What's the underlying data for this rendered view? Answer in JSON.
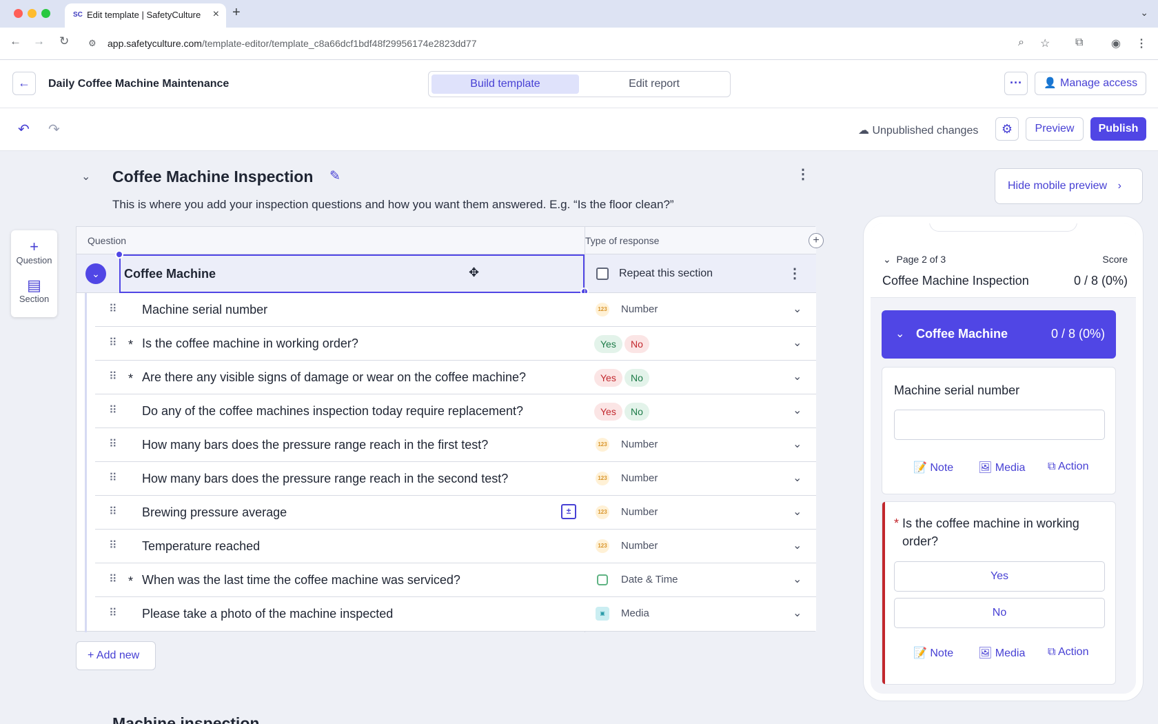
{
  "browser": {
    "tab_title": "Edit template | SafetyCulture",
    "tab_favicon": "SC",
    "url_domain": "app.safetyculture.com",
    "url_path": "/template-editor/template_c8a66dcf1bdf48f29956174e2823dd77"
  },
  "header": {
    "template_name": "Daily Coffee Machine Maintenance",
    "tab_build": "Build template",
    "tab_edit": "Edit report",
    "manage_access": "Manage access"
  },
  "actionbar": {
    "status": "Unpublished changes",
    "preview": "Preview",
    "publish": "Publish"
  },
  "page": {
    "title": "Coffee Machine Inspection",
    "description": "This is where you add your inspection questions and how you want them answered. E.g. “Is the floor clean?”",
    "hide_preview": "Hide mobile preview"
  },
  "tools": {
    "question": "Question",
    "section": "Section"
  },
  "table": {
    "col_question": "Question",
    "col_type": "Type of response",
    "section_name": "Coffee Machine",
    "repeat_label": "Repeat this section",
    "rows": [
      {
        "text": "Machine serial number",
        "required": "",
        "type": "Number",
        "icon": "123"
      },
      {
        "text": "Is the coffee machine in working order?",
        "required": "*",
        "yes": "Yes",
        "no": "No"
      },
      {
        "text": "Are there any visible signs of damage or wear on the coffee machine?",
        "required": "*",
        "yes": "Yes",
        "no": "No"
      },
      {
        "text": "Do any of the coffee machines inspection today require replacement?",
        "required": "",
        "yes": "Yes",
        "no": "No"
      },
      {
        "text": "How many bars does the pressure range reach in the first test?",
        "required": "",
        "type": "Number",
        "icon": "123"
      },
      {
        "text": "How many bars does the pressure range reach in the second test?",
        "required": "",
        "type": "Number",
        "icon": "123"
      },
      {
        "text": "Brewing pressure average",
        "required": "",
        "type": "Number",
        "icon": "123"
      },
      {
        "text": "Temperature reached",
        "required": "",
        "type": "Number",
        "icon": "123"
      },
      {
        "text": "When was the last time the coffee machine was serviced?",
        "required": "*",
        "type": "Date & Time"
      },
      {
        "text": "Please take a photo of the machine inspected",
        "required": "",
        "type": "Media"
      }
    ],
    "add_new": "Add new"
  },
  "next_section_title": "Machine inspection",
  "mobile": {
    "page_label": "Page 2 of 3",
    "score_label": "Score",
    "title": "Coffee Machine Inspection",
    "score": "0 / 8 (0%)",
    "section_name": "Coffee Machine",
    "section_score": "0 / 8 (0%)",
    "q1": "Machine serial number",
    "q2": "Is the coffee machine in working order?",
    "yes": "Yes",
    "no": "No",
    "note": "Note",
    "media": "Media",
    "action": "Action"
  }
}
